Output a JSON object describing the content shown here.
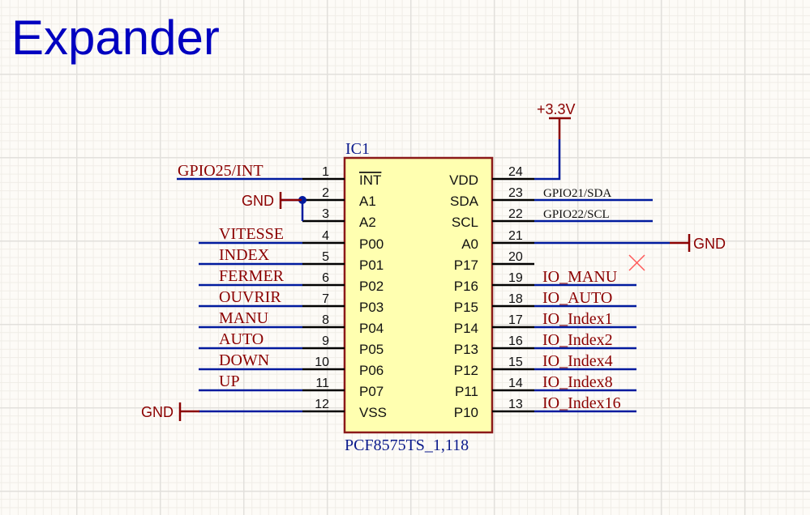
{
  "sheet_title": "Expander",
  "colors": {
    "title": "#0000c0",
    "wire": "#001a9e",
    "pin": "#000000",
    "net_label": "#8b0000",
    "power_port": "#8b0000",
    "component_body_fill": "#ffffb0",
    "component_body_border": "#8b1a1a",
    "designator": "#0a1a8c",
    "no_erc": "#ff4040"
  },
  "component": {
    "designator": "IC1",
    "comment": "PCF8575TS_1,118",
    "left_pins": [
      {
        "number": "1",
        "name": "INT",
        "overline": true,
        "net": "GPIO25/INT"
      },
      {
        "number": "2",
        "name": "A1",
        "net": "GND"
      },
      {
        "number": "3",
        "name": "A2",
        "net": "GND"
      },
      {
        "number": "4",
        "name": "P00",
        "net": "VITESSE"
      },
      {
        "number": "5",
        "name": "P01",
        "net": "INDEX"
      },
      {
        "number": "6",
        "name": "P02",
        "net": "FERMER"
      },
      {
        "number": "7",
        "name": "P03",
        "net": "OUVRIR"
      },
      {
        "number": "8",
        "name": "P04",
        "net": "MANU"
      },
      {
        "number": "9",
        "name": "P05",
        "net": "AUTO"
      },
      {
        "number": "10",
        "name": "P06",
        "net": "DOWN"
      },
      {
        "number": "11",
        "name": "P07",
        "net": "UP"
      },
      {
        "number": "12",
        "name": "VSS",
        "net": "GND"
      }
    ],
    "right_pins": [
      {
        "number": "24",
        "name": "VDD",
        "net": "+3.3V"
      },
      {
        "number": "23",
        "name": "SDA",
        "net": "GPIO21/SDA"
      },
      {
        "number": "22",
        "name": "SCL",
        "net": "GPIO22/SCL"
      },
      {
        "number": "21",
        "name": "A0",
        "net": "GND"
      },
      {
        "number": "20",
        "name": "P17",
        "net": ""
      },
      {
        "number": "19",
        "name": "P16",
        "net": "IO_MANU"
      },
      {
        "number": "18",
        "name": "P15",
        "net": "IO_AUTO"
      },
      {
        "number": "17",
        "name": "P14",
        "net": "IO_Index1"
      },
      {
        "number": "16",
        "name": "P13",
        "net": "IO_Index2"
      },
      {
        "number": "15",
        "name": "P12",
        "net": "IO_Index4"
      },
      {
        "number": "14",
        "name": "P11",
        "net": "IO_Index8"
      },
      {
        "number": "13",
        "name": "P10",
        "net": "IO_Index16"
      }
    ]
  },
  "net_labels": {
    "gpio25": "GPIO25/INT",
    "vitesse": "VITESSE",
    "index": "INDEX",
    "fermer": "FERMER",
    "ouvrir": "OUVRIR",
    "manu": "MANU",
    "auto": "AUTO",
    "down": "DOWN",
    "up": "UP",
    "sda": "GPIO21/SDA",
    "scl": "GPIO22/SCL",
    "io_manu": "IO_MANU",
    "io_auto": "IO_AUTO",
    "io_index1": "IO_Index1",
    "io_index2": "IO_Index2",
    "io_index4": "IO_Index4",
    "io_index8": "IO_Index8",
    "io_index16": "IO_Index16"
  },
  "power_ports": {
    "vcc": "+3.3V",
    "gnd_a1": "GND",
    "gnd_a0": "GND",
    "gnd_vss": "GND"
  },
  "no_erc_marker": "no-connect-pin-20"
}
